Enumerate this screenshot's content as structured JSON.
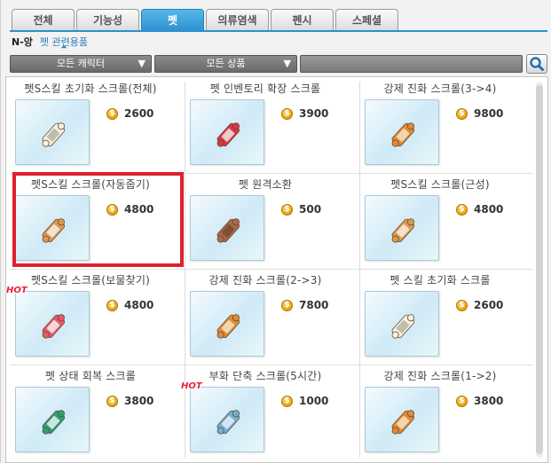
{
  "tabs": [
    {
      "label": "전체",
      "active": false
    },
    {
      "label": "기능성",
      "active": false
    },
    {
      "label": "펫",
      "active": true
    },
    {
      "label": "의류염색",
      "active": false
    },
    {
      "label": "펜시",
      "active": false
    },
    {
      "label": "스페셜",
      "active": false
    }
  ],
  "subnav": {
    "server": "N-앙",
    "category": "펫 관련용품"
  },
  "filters": {
    "character": "모든 캐릭터",
    "product": "모든 상품",
    "arrow": "▼",
    "search_value": ""
  },
  "currency_symbol": "$",
  "hot_label": "HOT",
  "colors": {
    "accent": "#2c8fd0",
    "highlight": "#e0202e",
    "hot": "#e8223a"
  },
  "items": [
    {
      "name": "펫S스킬 초기화 스크롤(전체)",
      "price": "2600",
      "hot": false,
      "scroll": "white"
    },
    {
      "name": "펫 인벤토리 확장 스크롤",
      "price": "3900",
      "hot": false,
      "scroll": "red"
    },
    {
      "name": "강제 진화 스크롤(3->4)",
      "price": "9800",
      "hot": false,
      "scroll": "orange"
    },
    {
      "name": "펫S스킬 스크롤(자동줍기)",
      "price": "4800",
      "hot": false,
      "scroll": "tan",
      "highlighted": true
    },
    {
      "name": "펫 원격소환",
      "price": "500",
      "hot": false,
      "scroll": "brown"
    },
    {
      "name": "펫S스킬 스크롤(근성)",
      "price": "4800",
      "hot": false,
      "scroll": "tan"
    },
    {
      "name": "펫S스킬 스크롤(보물찾기)",
      "price": "4800",
      "hot": true,
      "scroll": "pink"
    },
    {
      "name": "강제 진화 스크롤(2->3)",
      "price": "7800",
      "hot": false,
      "scroll": "orange"
    },
    {
      "name": "펫 스킬 초기화 스크롤",
      "price": "2600",
      "hot": false,
      "scroll": "white"
    },
    {
      "name": "펫 상태 회복 스크롤",
      "price": "3800",
      "hot": false,
      "scroll": "green"
    },
    {
      "name": "부화 단축 스크롤(5시간)",
      "price": "1000",
      "hot": true,
      "scroll": "blue"
    },
    {
      "name": "강제 진화 스크롤(1->2)",
      "price": "3800",
      "hot": false,
      "scroll": "orange"
    }
  ]
}
